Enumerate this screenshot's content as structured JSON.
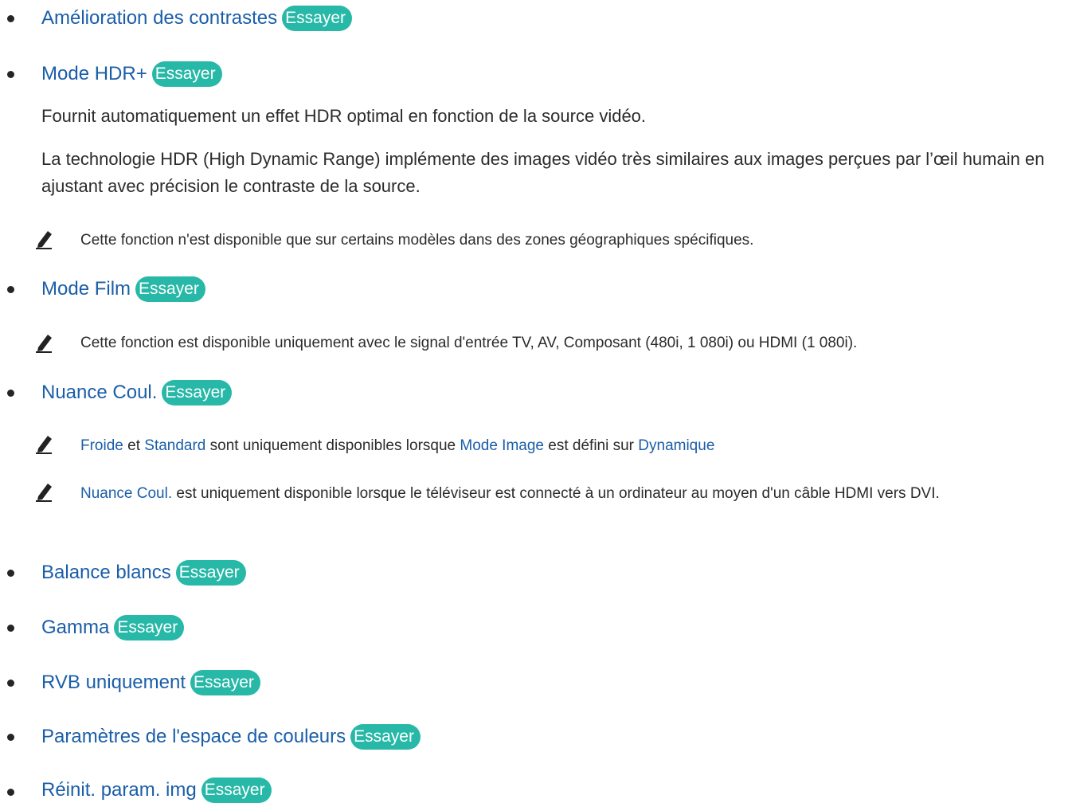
{
  "accent": "#1a5ea9",
  "try_color": "#27b8a7",
  "items": [
    {
      "label": "Amélioration des contrastes",
      "try": "Essayer"
    },
    {
      "label": "Mode HDR+",
      "try": "Essayer"
    },
    {
      "label": "Mode Film",
      "try": "Essayer"
    },
    {
      "label": "Nuance Coul.",
      "try": "Essayer"
    },
    {
      "label": "Balance blancs",
      "try": "Essayer"
    },
    {
      "label": "Gamma",
      "try": "Essayer"
    },
    {
      "label": "RVB uniquement",
      "try": "Essayer"
    },
    {
      "label": "Paramètres de l'espace de couleurs",
      "try": "Essayer"
    },
    {
      "label": "Réinit. param. img",
      "try": "Essayer"
    }
  ],
  "hdr_desc_1": "Fournit automatiquement un effet HDR optimal en fonction de la source vidéo.",
  "hdr_desc_2": "La technologie HDR (High Dynamic Range) implémente des images vidéo très similaires aux images perçues par l’œil humain en ajustant avec précision le contraste de la source.",
  "note_hdr": "Cette fonction n'est disponible que sur certains modèles dans des zones géographiques spécifiques.",
  "note_film": "Cette fonction est disponible uniquement avec le signal d'entrée TV, AV, Composant (480i, 1 080i) ou HDMI (1 080i).",
  "note_nuance_1": {
    "kw1": "Froide",
    "t1": " et ",
    "kw2": "Standard",
    "t2": " sont uniquement disponibles lorsque ",
    "kw3": "Mode Image",
    "t3": " est défini sur ",
    "kw4": "Dynamique"
  },
  "note_nuance_2": {
    "kw1": "Nuance Coul.",
    "t1": " est uniquement disponible lorsque le téléviseur est connecté à un ordinateur au moyen d'un câble HDMI vers DVI."
  },
  "icons": {
    "bullet": "bullet-dot",
    "note": "pencil-icon"
  }
}
